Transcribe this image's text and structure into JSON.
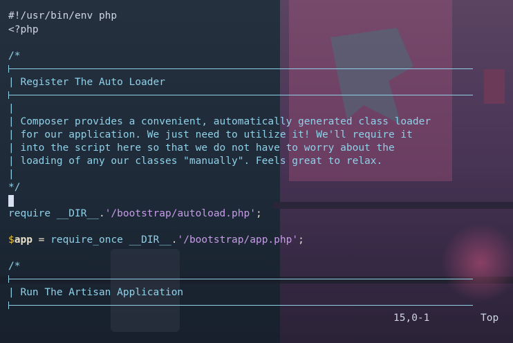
{
  "editor": {
    "shebang": "#!/usr/bin/env php",
    "php_open": "<?php",
    "comment_open": "/*",
    "comment_close": "*/",
    "section1_title": "| Register The Auto Loader",
    "section2_title": "| Run The Artisan Application",
    "desc_lines": [
      "| Composer provides a convenient, automatically generated class loader",
      "| for our application. We just need to utilize it! We'll require it",
      "| into the script here so that we do not have to worry about the",
      "| loading of any our classes \"manually\". Feels great to relax."
    ],
    "require_kw": "require",
    "require_dir": "__DIR__",
    "require_dot": ".",
    "require_path": "'/bootstrap/autoload.php'",
    "require_end": ";",
    "app_dollar": "$",
    "app_name": "app",
    "app_eq": "=",
    "app_kw": "require_once",
    "app_dir": "__DIR__",
    "app_dot": ".",
    "app_path": "'/bootstrap/app.php'",
    "app_end": ";",
    "pipe_char": "|"
  },
  "statusline": {
    "position": "15,0-1",
    "scroll": "Top"
  },
  "colors": {
    "comment": "#8fd1e8",
    "string": "#c79be8",
    "variable_sigil": "#e8c33c",
    "text": "#cfd6e2"
  }
}
